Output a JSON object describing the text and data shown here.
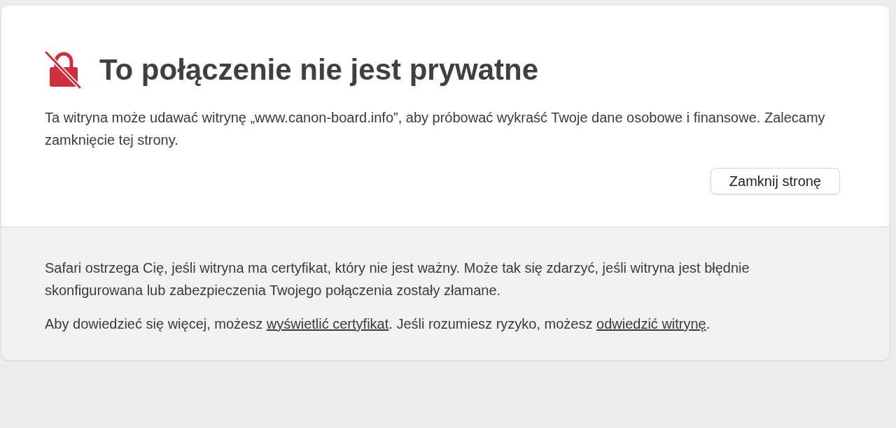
{
  "title": "To połączenie nie jest prywatne",
  "warning": "Ta witryna może udawać witrynę „www.canon-board.info”, aby próbować wykraść Twoje dane osobowe i finansowe. Zalecamy zamknięcie tej strony.",
  "close_button": "Zamknij stronę",
  "details": [
    {
      "parts": [
        {
          "kind": "text",
          "text": "Safari ostrzega Cię, jeśli witryna ma certyfikat, który nie jest ważny. Może tak się zdarzyć, jeśli witryna jest błędnie skonfigurowana lub zabezpieczenia Twojego połączenia zostały złamane."
        }
      ]
    },
    {
      "parts": [
        {
          "kind": "text",
          "text": "Aby dowiedzieć się więcej, możesz "
        },
        {
          "kind": "link",
          "text": "wyświetlić certyfikat"
        },
        {
          "kind": "text",
          "text": ". Jeśli rozumiesz ryzyko, możesz "
        },
        {
          "kind": "link",
          "text": "odwiedzić witrynę"
        },
        {
          "kind": "text",
          "text": "."
        }
      ]
    }
  ]
}
